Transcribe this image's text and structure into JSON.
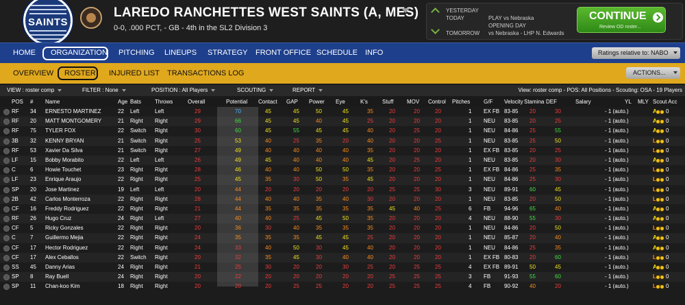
{
  "header": {
    "logo_text": "SAINTS",
    "team_title": "LAREDO RANCHETTES WEST SAINTS (A, MES)",
    "team_sub": "0-0, .000 PCT, - GB - 4th in the SL2 Division 3"
  },
  "schedule": {
    "yesterday_label": "YESTERDAY",
    "today_label": "TODAY",
    "today_value": "PLAY vs Nebraska",
    "today_value2": "OPENING DAY",
    "tomorrow_label": "TOMORROW",
    "tomorrow_value": "vs Nebraska - LHP N. Edwards"
  },
  "continue_button": {
    "label": "CONTINUE",
    "sub": "Review OD roster..."
  },
  "nav": {
    "items": [
      "HOME",
      "ORGANIZATION",
      "PITCHING",
      "LINEUPS",
      "STRATEGY",
      "FRONT OFFICE",
      "SCHEDULE",
      "INFO"
    ],
    "ratings_label": "Ratings relative to: NABO"
  },
  "subnav": {
    "items": [
      "OVERVIEW",
      "ROSTER",
      "INJURED LIST",
      "TRANSACTIONS LOG"
    ],
    "actions_label": "ACTIONS..."
  },
  "filters": {
    "view": "VIEW : roster comp",
    "filter": "FILTER : None",
    "position": "POSITION : All Players",
    "scouting": "SCOUTING",
    "report": "REPORT",
    "summary": "View: roster comp - POS: All Positions - Scouting: OSA - 19 Players"
  },
  "columns": [
    "POS",
    "#",
    "Name",
    "Age",
    "Bats",
    "Throws",
    "Overall",
    "Potential",
    "Contact",
    "GAP",
    "Power",
    "Eye",
    "K's",
    "Stuff",
    "MOV",
    "Control",
    "Pitches",
    "G/F",
    "Velocity",
    "Stamina",
    "DEF",
    "Salary",
    "YL",
    "MLY",
    "Scout Acc"
  ],
  "players": [
    [
      "RF",
      "34",
      "ERNESTO MARTINEZ",
      "22",
      "Left",
      "Left",
      "29",
      "70",
      "45",
      "45",
      "50",
      "45",
      "35",
      "20",
      "20",
      "20",
      "1",
      "EX FB",
      "83-85",
      "20",
      "30",
      "- 1 (auto.)",
      "0",
      "Avg"
    ],
    [
      "RF",
      "20",
      "MATT MONTGOMERY",
      "21",
      "Right",
      "Right",
      "29",
      "66",
      "45",
      "45",
      "40",
      "45",
      "25",
      "20",
      "20",
      "20",
      "1",
      "NEU",
      "83-85",
      "20",
      "25",
      "- 1 (auto.)",
      "0",
      "Avg"
    ],
    [
      "RF",
      "75",
      "TYLER FOX",
      "22",
      "Switch",
      "Right",
      "30",
      "60",
      "45",
      "55",
      "45",
      "45",
      "40",
      "20",
      "25",
      "20",
      "1",
      "NEU",
      "84-86",
      "25",
      "55",
      "- 1 (auto.)",
      "0",
      "Avg"
    ],
    [
      "3B",
      "32",
      "KENNY BRYAN",
      "21",
      "Switch",
      "Right",
      "25",
      "53",
      "40",
      "25",
      "35",
      "20",
      "40",
      "20",
      "20",
      "25",
      "1",
      "NEU",
      "83-85",
      "25",
      "50",
      "- 1 (auto.)",
      "0",
      "Low"
    ],
    [
      "RF",
      "53",
      "Xavier Da Silva",
      "21",
      "Switch",
      "Right",
      "27",
      "49",
      "40",
      "40",
      "40",
      "40",
      "35",
      "20",
      "20",
      "20",
      "1",
      "EX FB",
      "83-85",
      "20",
      "25",
      "- 1 (auto.)",
      "0",
      "Low"
    ],
    [
      "LF",
      "15",
      "Bobby Morabito",
      "22",
      "Left",
      "Left",
      "26",
      "49",
      "45",
      "40",
      "40",
      "40",
      "45",
      "20",
      "25",
      "20",
      "1",
      "NEU",
      "83-85",
      "20",
      "30",
      "- 1 (auto.)",
      "0",
      "Avg"
    ],
    [
      "C",
      "6",
      "Howie Touchet",
      "23",
      "Right",
      "Right",
      "28",
      "46",
      "40",
      "40",
      "50",
      "50",
      "35",
      "20",
      "20",
      "25",
      "1",
      "EX FB",
      "84-86",
      "25",
      "35",
      "- 1 (auto.)",
      "0",
      "Low"
    ],
    [
      "LF",
      "23",
      "Enrique Araujo",
      "22",
      "Right",
      "Right",
      "25",
      "45",
      "35",
      "30",
      "50",
      "35",
      "45",
      "20",
      "20",
      "20",
      "1",
      "NEU",
      "84-86",
      "25",
      "30",
      "- 1 (auto.)",
      "0",
      "Low"
    ],
    [
      "SP",
      "20",
      "Jose Martinez",
      "19",
      "Left",
      "Left",
      "20",
      "44",
      "20",
      "20",
      "20",
      "20",
      "20",
      "25",
      "25",
      "30",
      "3",
      "NEU",
      "89-91",
      "60",
      "45",
      "- 1 (auto.)",
      "0",
      "Low"
    ],
    [
      "2B",
      "42",
      "Carlos Monterroza",
      "22",
      "Right",
      "Right",
      "28",
      "44",
      "40",
      "40",
      "35",
      "40",
      "30",
      "20",
      "20",
      "20",
      "1",
      "NEU",
      "83-85",
      "20",
      "50",
      "- 1 (auto.)",
      "0",
      "Low"
    ],
    [
      "CF",
      "16",
      "Freddy Rodriguez",
      "22",
      "Right",
      "Right",
      "21",
      "44",
      "35",
      "35",
      "35",
      "35",
      "35",
      "45",
      "40",
      "25",
      "6",
      "FB",
      "94-96",
      "65",
      "40",
      "- 1 (auto.)",
      "0",
      "Avg"
    ],
    [
      "RF",
      "26",
      "Hugo Cruz",
      "24",
      "Right",
      "Left",
      "27",
      "40",
      "40",
      "25",
      "45",
      "50",
      "35",
      "20",
      "20",
      "20",
      "4",
      "NEU",
      "88-90",
      "55",
      "30",
      "- 1 (auto.)",
      "0",
      "Avg"
    ],
    [
      "CF",
      "5",
      "Ricky Gonzales",
      "22",
      "Right",
      "Right",
      "20",
      "36",
      "30",
      "40",
      "35",
      "35",
      "35",
      "20",
      "20",
      "20",
      "1",
      "NEU",
      "84-86",
      "20",
      "50",
      "- 1 (auto.)",
      "0",
      "Low"
    ],
    [
      "C",
      "7",
      "Guillermo Mejia",
      "22",
      "Right",
      "Right",
      "24",
      "35",
      "35",
      "35",
      "45",
      "45",
      "25",
      "20",
      "20",
      "20",
      "1",
      "NEU",
      "85-87",
      "20",
      "40",
      "- 1 (auto.)",
      "0",
      "Avg"
    ],
    [
      "CF",
      "17",
      "Hector Rodriguez",
      "22",
      "Right",
      "Right",
      "24",
      "33",
      "40",
      "50",
      "30",
      "45",
      "40",
      "20",
      "20",
      "20",
      "1",
      "NEU",
      "84-86",
      "25",
      "35",
      "- 1 (auto.)",
      "0",
      "Avg"
    ],
    [
      "CF",
      "17",
      "Alex Ceballos",
      "22",
      "Switch",
      "Right",
      "20",
      "32",
      "35",
      "45",
      "30",
      "40",
      "40",
      "20",
      "20",
      "20",
      "1",
      "EX FB",
      "80-83",
      "20",
      "60",
      "- 1 (auto.)",
      "0",
      "Low"
    ],
    [
      "SS",
      "45",
      "Danny Arias",
      "24",
      "Right",
      "Right",
      "21",
      "25",
      "30",
      "20",
      "20",
      "30",
      "25",
      "20",
      "25",
      "25",
      "4",
      "EX FB",
      "89-91",
      "50",
      "45",
      "- 1 (auto.)",
      "0",
      "Avg"
    ],
    [
      "SP",
      "8",
      "Ray Buell",
      "24",
      "Right",
      "Right",
      "20",
      "22",
      "20",
      "20",
      "20",
      "20",
      "20",
      "25",
      "25",
      "25",
      "3",
      "FB",
      "91-93",
      "55",
      "60",
      "- 1 (auto.)",
      "0",
      "Low"
    ],
    [
      "SP",
      "11",
      "Chan-koo Kim",
      "18",
      "Right",
      "Right",
      "20",
      "20",
      "20",
      "25",
      "25",
      "20",
      "20",
      "25",
      "25",
      "25",
      "4",
      "FB",
      "90-92",
      "40",
      "20",
      "- 1 (auto.)",
      "0",
      "Low"
    ]
  ]
}
